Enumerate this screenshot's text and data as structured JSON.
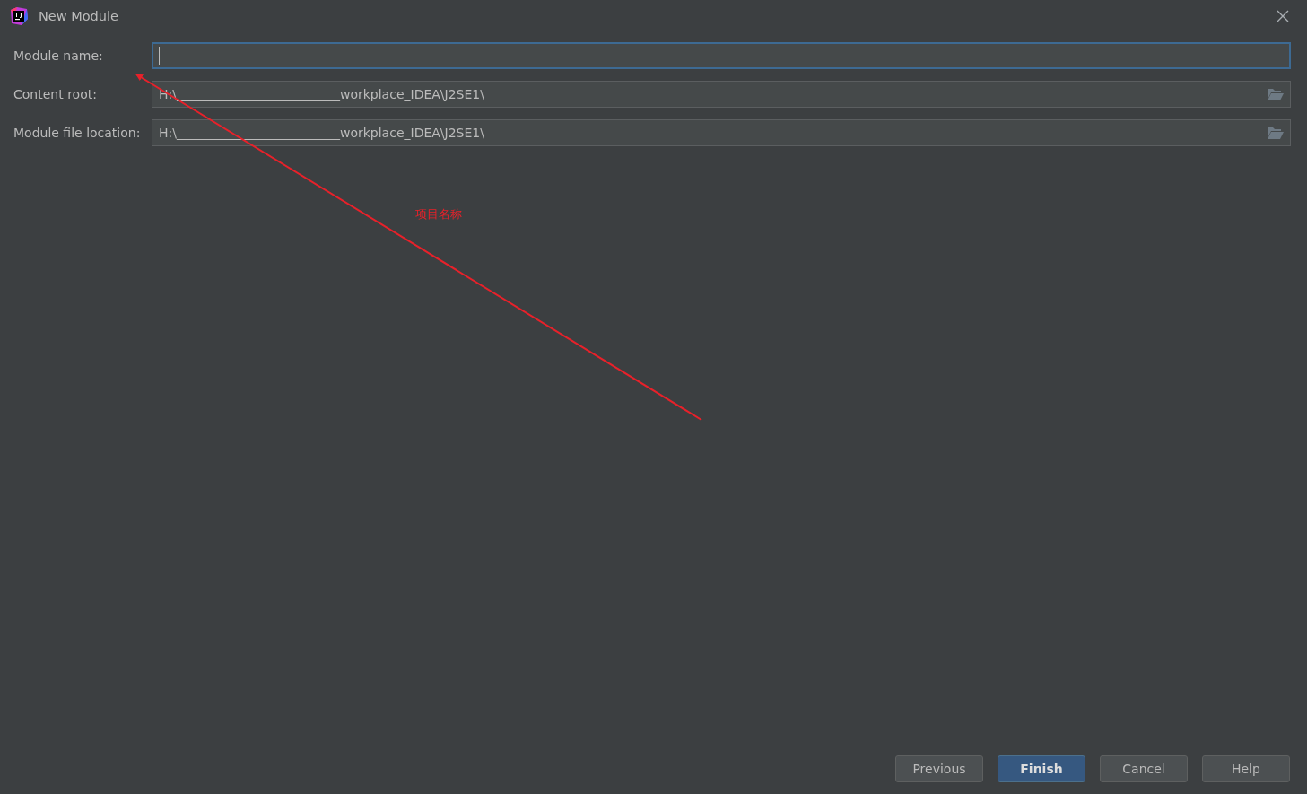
{
  "window": {
    "title": "New Module"
  },
  "fields": [
    {
      "label": "Module name:",
      "kind": "text",
      "focused": true
    },
    {
      "label": "Content root:",
      "kind": "path",
      "value": "H:\\__________________________workplace_IDEA\\J2SE1\\",
      "focused": false
    },
    {
      "label": "Module file location:",
      "kind": "path",
      "value": "H:\\__________________________workplace_IDEA\\J2SE1\\",
      "focused": false
    }
  ],
  "annotation": {
    "text": "项目名称"
  },
  "buttons": [
    {
      "label": "Previous",
      "default": false
    },
    {
      "label": "Finish",
      "default": true
    },
    {
      "label": "Cancel",
      "default": false
    },
    {
      "label": "Help",
      "default": false
    }
  ]
}
